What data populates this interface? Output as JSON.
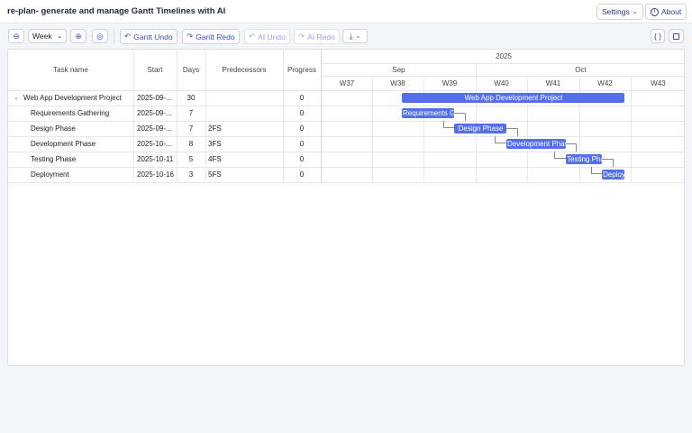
{
  "header": {
    "title": "re-plan- generate and manage Gantt Timelines with AI",
    "settings_label": "Settings",
    "about_label": "About"
  },
  "toolbar": {
    "view_select": "Week",
    "gantt_undo": "Gantt Undo",
    "gantt_redo": "Gantt Redo",
    "ai_undo": "AI Undo",
    "ai_redo": "AI Redo",
    "json_label": "{ }"
  },
  "grid": {
    "columns": [
      "Task name",
      "Start",
      "Days",
      "Predecessors",
      "Progress"
    ],
    "rows": [
      {
        "name": "Web App Development Project",
        "start": "2025-09-...",
        "days": "30",
        "pred": "",
        "progress": "0"
      },
      {
        "name": "Requirements Gathering",
        "start": "2025-09-...",
        "days": "7",
        "pred": "",
        "progress": "0"
      },
      {
        "name": "Design Phase",
        "start": "2025-09-...",
        "days": "7",
        "pred": "2FS",
        "progress": "0"
      },
      {
        "name": "Development Phase",
        "start": "2025-10-...",
        "days": "8",
        "pred": "3FS",
        "progress": "0"
      },
      {
        "name": "Testing Phase",
        "start": "2025-10-11",
        "days": "5",
        "pred": "4FS",
        "progress": "0"
      },
      {
        "name": "Deployment",
        "start": "2025-10-16",
        "days": "3",
        "pred": "5FS",
        "progress": "0"
      }
    ]
  },
  "timeline": {
    "year": "2025",
    "months": [
      "Sep",
      "Oct"
    ],
    "weeks": [
      "W37",
      "W38",
      "W39",
      "W40",
      "W41",
      "W42",
      "W43"
    ],
    "bars": [
      "Web App Development Project",
      "Requirements G",
      "Design Phase",
      "Development Phas",
      "Testing Pha",
      "Deploy"
    ]
  },
  "colors": {
    "accent": "#5470e8",
    "brand": "#2b3a7a"
  }
}
